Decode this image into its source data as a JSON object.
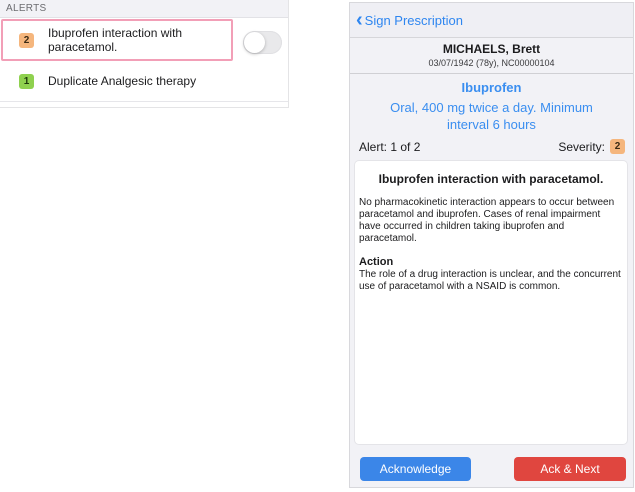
{
  "alerts": {
    "header": "ALERTS",
    "items": [
      {
        "severity": "2",
        "text": "Ibuprofen interaction with paracetamol.",
        "color": "#f5b67d"
      },
      {
        "severity": "1",
        "text": "Duplicate Analgesic therapy",
        "color": "#8fd14f"
      }
    ]
  },
  "nav": {
    "back_label": "Sign Prescription"
  },
  "patient": {
    "name": "MICHAELS, Brett",
    "details": "03/07/1942 (78y), NC00000104"
  },
  "drug": {
    "name": "Ibuprofen",
    "dose": "Oral, 400 mg twice a day. Minimum interval 6 hours"
  },
  "alert_info": {
    "position": "Alert: 1 of 2",
    "severity_label": "Severity:",
    "severity_value": "2"
  },
  "detail": {
    "title": "Ibuprofen interaction with paracetamol.",
    "body": "No pharmacokinetic interaction appears to occur between paracetamol and ibuprofen. Cases of renal impairment have occurred in children taking ibuprofen and paracetamol.",
    "action_title": "Action",
    "action_body": "The role of a drug interaction is unclear, and the concurrent use of paracetamol with a NSAID is common."
  },
  "buttons": {
    "acknowledge": "Acknowledge",
    "ack_next": "Ack & Next"
  },
  "colors": {
    "accent_blue": "#3a8ef0",
    "button_blue": "#3b86e8",
    "button_red": "#e0463f",
    "selection_pink": "#f29fb7"
  }
}
